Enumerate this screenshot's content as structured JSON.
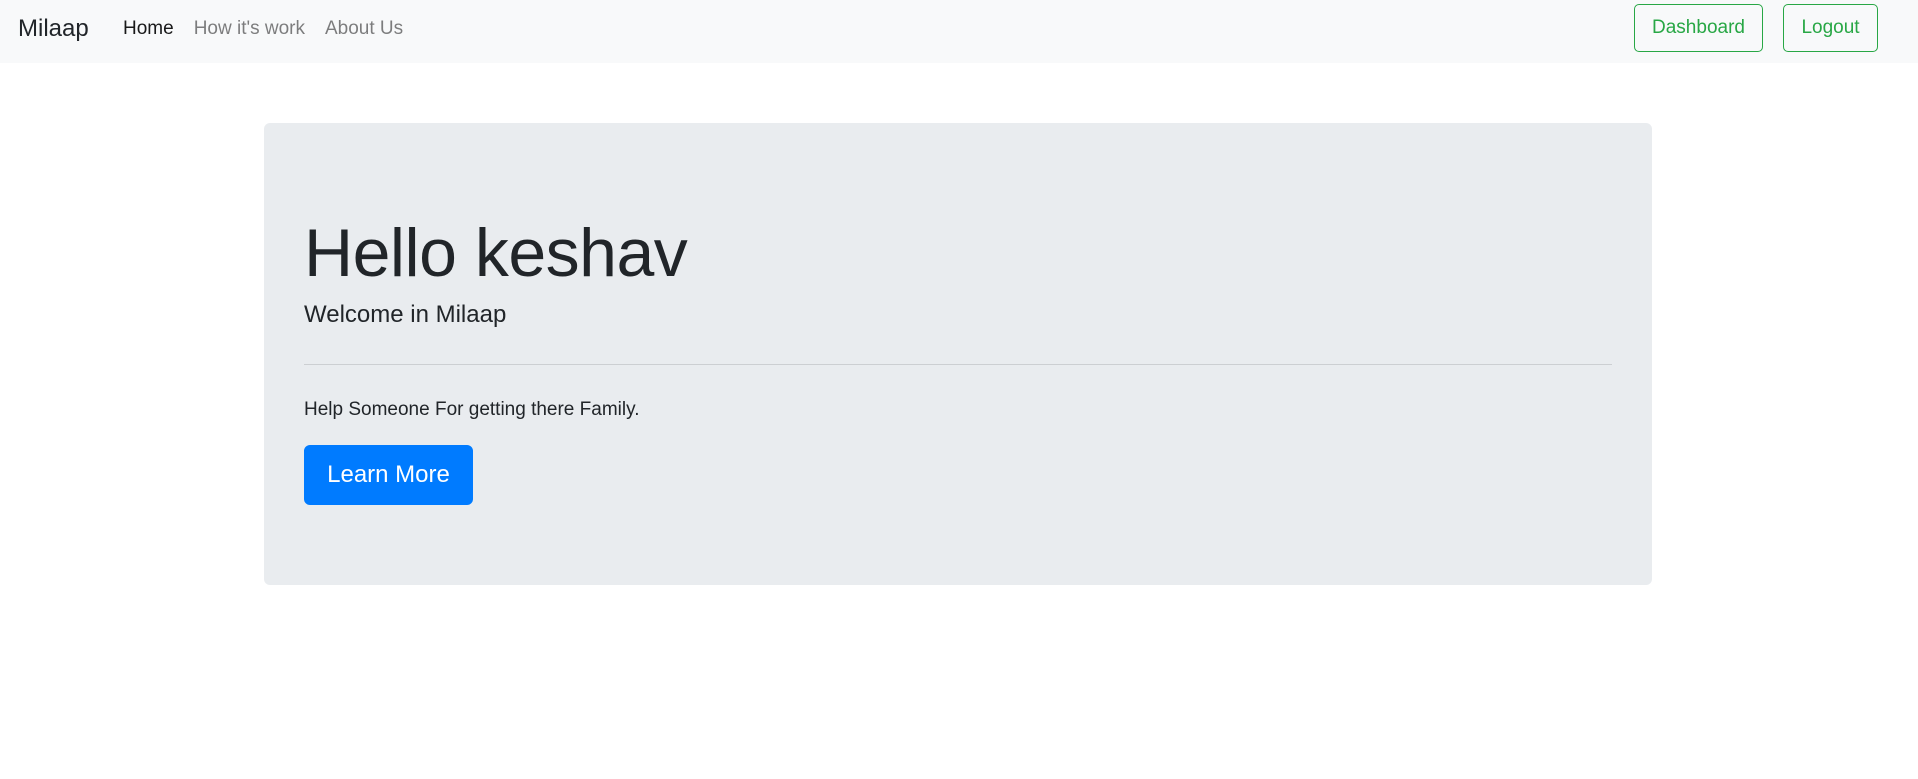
{
  "navbar": {
    "brand": "Milaap",
    "links": [
      {
        "label": "Home",
        "active": true
      },
      {
        "label": "How it's work",
        "active": false
      },
      {
        "label": "About Us",
        "active": false
      }
    ],
    "dashboard_label": "Dashboard",
    "logout_label": "Logout"
  },
  "jumbotron": {
    "heading": "Hello keshav",
    "lead": "Welcome in Milaap",
    "text": "Help Someone For getting there Family.",
    "button_label": "Learn More"
  },
  "colors": {
    "navbar_bg": "#f8f9fa",
    "jumbotron_bg": "#e9ecef",
    "success": "#28a745",
    "primary": "#007bff"
  }
}
